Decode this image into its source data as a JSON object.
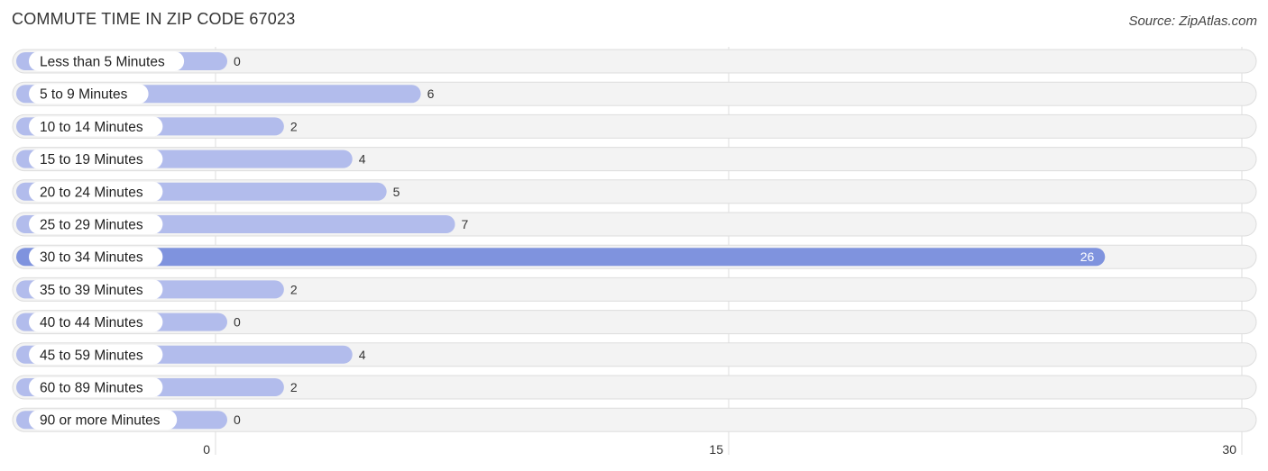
{
  "header": {
    "title": "COMMUTE TIME IN ZIP CODE 67023",
    "source": "Source: ZipAtlas.com"
  },
  "colors": {
    "bar": "#b2bcec",
    "bar_highlight": "#7f93de",
    "track": "#f3f3f3",
    "track_border": "#dddddd",
    "gridline": "#dddddd"
  },
  "chart_data": {
    "type": "bar",
    "orientation": "horizontal",
    "title": "COMMUTE TIME IN ZIP CODE 67023",
    "xlabel": "",
    "ylabel": "",
    "categories": [
      "Less than 5 Minutes",
      "5 to 9 Minutes",
      "10 to 14 Minutes",
      "15 to 19 Minutes",
      "20 to 24 Minutes",
      "25 to 29 Minutes",
      "30 to 34 Minutes",
      "35 to 39 Minutes",
      "40 to 44 Minutes",
      "45 to 59 Minutes",
      "60 to 89 Minutes",
      "90 or more Minutes"
    ],
    "values": [
      0,
      6,
      2,
      4,
      5,
      7,
      26,
      2,
      0,
      4,
      2,
      0
    ],
    "highlight_index": 6,
    "xlim": [
      0,
      30
    ],
    "xticks": [
      0,
      15,
      30
    ],
    "grid": true,
    "legend": "none"
  }
}
